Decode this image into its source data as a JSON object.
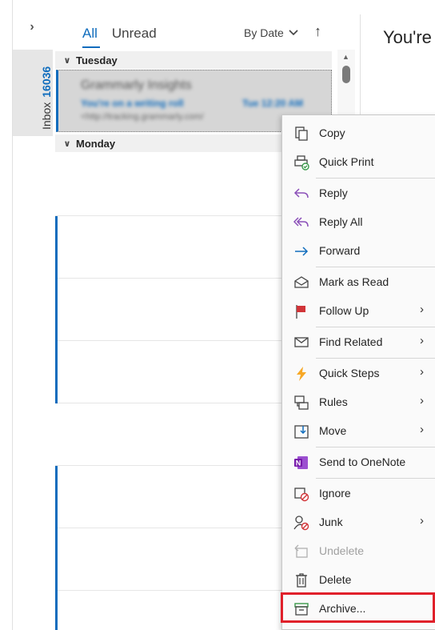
{
  "rail": {
    "expand_glyph": "›",
    "folder_name": "Inbox",
    "unread_count": "16036"
  },
  "list": {
    "tabs": [
      {
        "label": "All",
        "active": true
      },
      {
        "label": "Unread",
        "active": false
      }
    ],
    "sort_label": "By Date",
    "sort_direction_glyph": "↑",
    "groups": [
      {
        "label": "Tuesday"
      },
      {
        "label": "Monday"
      }
    ],
    "selected_message": {
      "sender": "Grammarly Insights",
      "subject": "You're on a writing roll",
      "time": "Tue 12:20 AM",
      "preview": "<http://tracking.grammarly.com/"
    }
  },
  "reading": {
    "title": "You're"
  },
  "context_menu": {
    "items": [
      {
        "label": "Copy",
        "icon": "copy-icon",
        "submenu": false,
        "disabled": false
      },
      {
        "label": "Quick Print",
        "icon": "print-icon",
        "submenu": false,
        "disabled": false
      },
      {
        "label": "Reply",
        "icon": "reply-icon",
        "submenu": false,
        "disabled": false
      },
      {
        "label": "Reply All",
        "icon": "reply-all-icon",
        "submenu": false,
        "disabled": false
      },
      {
        "label": "Forward",
        "icon": "forward-icon",
        "submenu": false,
        "disabled": false
      },
      {
        "label": "Mark as Read",
        "icon": "envelope-open-icon",
        "submenu": false,
        "disabled": false
      },
      {
        "label": "Follow Up",
        "icon": "flag-icon",
        "submenu": true,
        "disabled": false
      },
      {
        "label": "Find Related",
        "icon": "find-related-icon",
        "submenu": true,
        "disabled": false
      },
      {
        "label": "Quick Steps",
        "icon": "lightning-icon",
        "submenu": true,
        "disabled": false
      },
      {
        "label": "Rules",
        "icon": "rules-icon",
        "submenu": true,
        "disabled": false
      },
      {
        "label": "Move",
        "icon": "move-icon",
        "submenu": true,
        "disabled": false
      },
      {
        "label": "Send to OneNote",
        "icon": "onenote-icon",
        "submenu": false,
        "disabled": false
      },
      {
        "label": "Ignore",
        "icon": "ignore-icon",
        "submenu": false,
        "disabled": false
      },
      {
        "label": "Junk",
        "icon": "junk-icon",
        "submenu": true,
        "disabled": false
      },
      {
        "label": "Undelete",
        "icon": "undelete-icon",
        "submenu": false,
        "disabled": true
      },
      {
        "label": "Delete",
        "icon": "trash-icon",
        "submenu": false,
        "disabled": false
      },
      {
        "label": "Archive...",
        "icon": "archive-icon",
        "submenu": false,
        "disabled": false
      }
    ],
    "submenu_glyph": "›"
  },
  "colors": {
    "accent": "#0f6cbd",
    "highlight_border": "#e0202a",
    "onenote": "#7719aa",
    "flag": "#d13438",
    "lightning": "#f7a826",
    "archive": "#3a9a4a"
  }
}
